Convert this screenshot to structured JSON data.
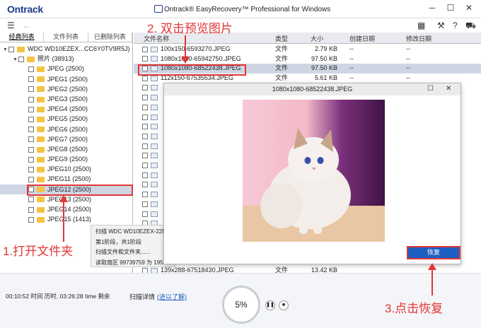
{
  "app": {
    "logo": "Ontrack",
    "title": "Ontrack® EasyRecovery™ Professional for Windows"
  },
  "tabs": [
    "经典列表",
    "文件列表",
    "已删除列表"
  ],
  "tree": {
    "drive": "WDC WD10EZEX...CC6Y0TV9R5J)",
    "photos": "照片 (38913)",
    "folders": [
      "JPEG (2500)",
      "JPEG1 (2500)",
      "JPEG2 (2500)",
      "JPEG3 (2500)",
      "JPEG4 (2500)",
      "JPEG5 (2500)",
      "JPEG6 (2500)",
      "JPEG7 (2500)",
      "JPEG8 (2500)",
      "JPEG9 (2500)",
      "JPEG10 (2500)",
      "JPEG11 (2500)",
      "JPEG12 (2500)",
      "JPEG13 (2500)",
      "JPEG14 (2500)",
      "JPEG15 (1413)"
    ]
  },
  "columns": [
    "文件名称",
    "类型",
    "大小",
    "创建日期",
    "修改日期"
  ],
  "files": [
    {
      "name": "100x150-6‪593270.JPEG",
      "type": "文件",
      "size": "2.79 KB",
      "created": "--",
      "modified": "--"
    },
    {
      "name": "1080x1080-65942750.JPEG",
      "type": "文件",
      "size": "97.50 KB",
      "created": "--",
      "modified": "--"
    },
    {
      "name": "1080x1080-68522438.JPEG",
      "type": "文件",
      "size": "97.50 KB",
      "created": "--",
      "modified": "--"
    },
    {
      "name": "112x150-67535534.JPEG",
      "type": "文件",
      "size": "5.61 KB",
      "created": "--",
      "modified": "--"
    }
  ],
  "last_file": {
    "name": "139x288-67518430.JPEG",
    "type": "文件",
    "size": "13.42 KB"
  },
  "tooltip": [
    "扫描 WDC WD10EZEX-22M",
    "第1阶段，共1阶段",
    "扫描文件和文件夹......",
    "读取扇区 99739759 为 195"
  ],
  "status": {
    "time": "00:10:52 时间 历时, 03:26:28 time 剩余",
    "scan_label": "扫描详情",
    "scan_link": "(进以了解)",
    "progress": "5%"
  },
  "preview": {
    "title": "1080x1080-68522438.JPEG",
    "restore": "恢复"
  },
  "annotations": {
    "step1": "1.打开文件夹",
    "step2": "2. 双击预览图片",
    "step3": "3.点击恢复"
  },
  "colors": {
    "accent": "#1d5fc0",
    "annotation": "#e23636",
    "selection": "#cfd6e3"
  }
}
